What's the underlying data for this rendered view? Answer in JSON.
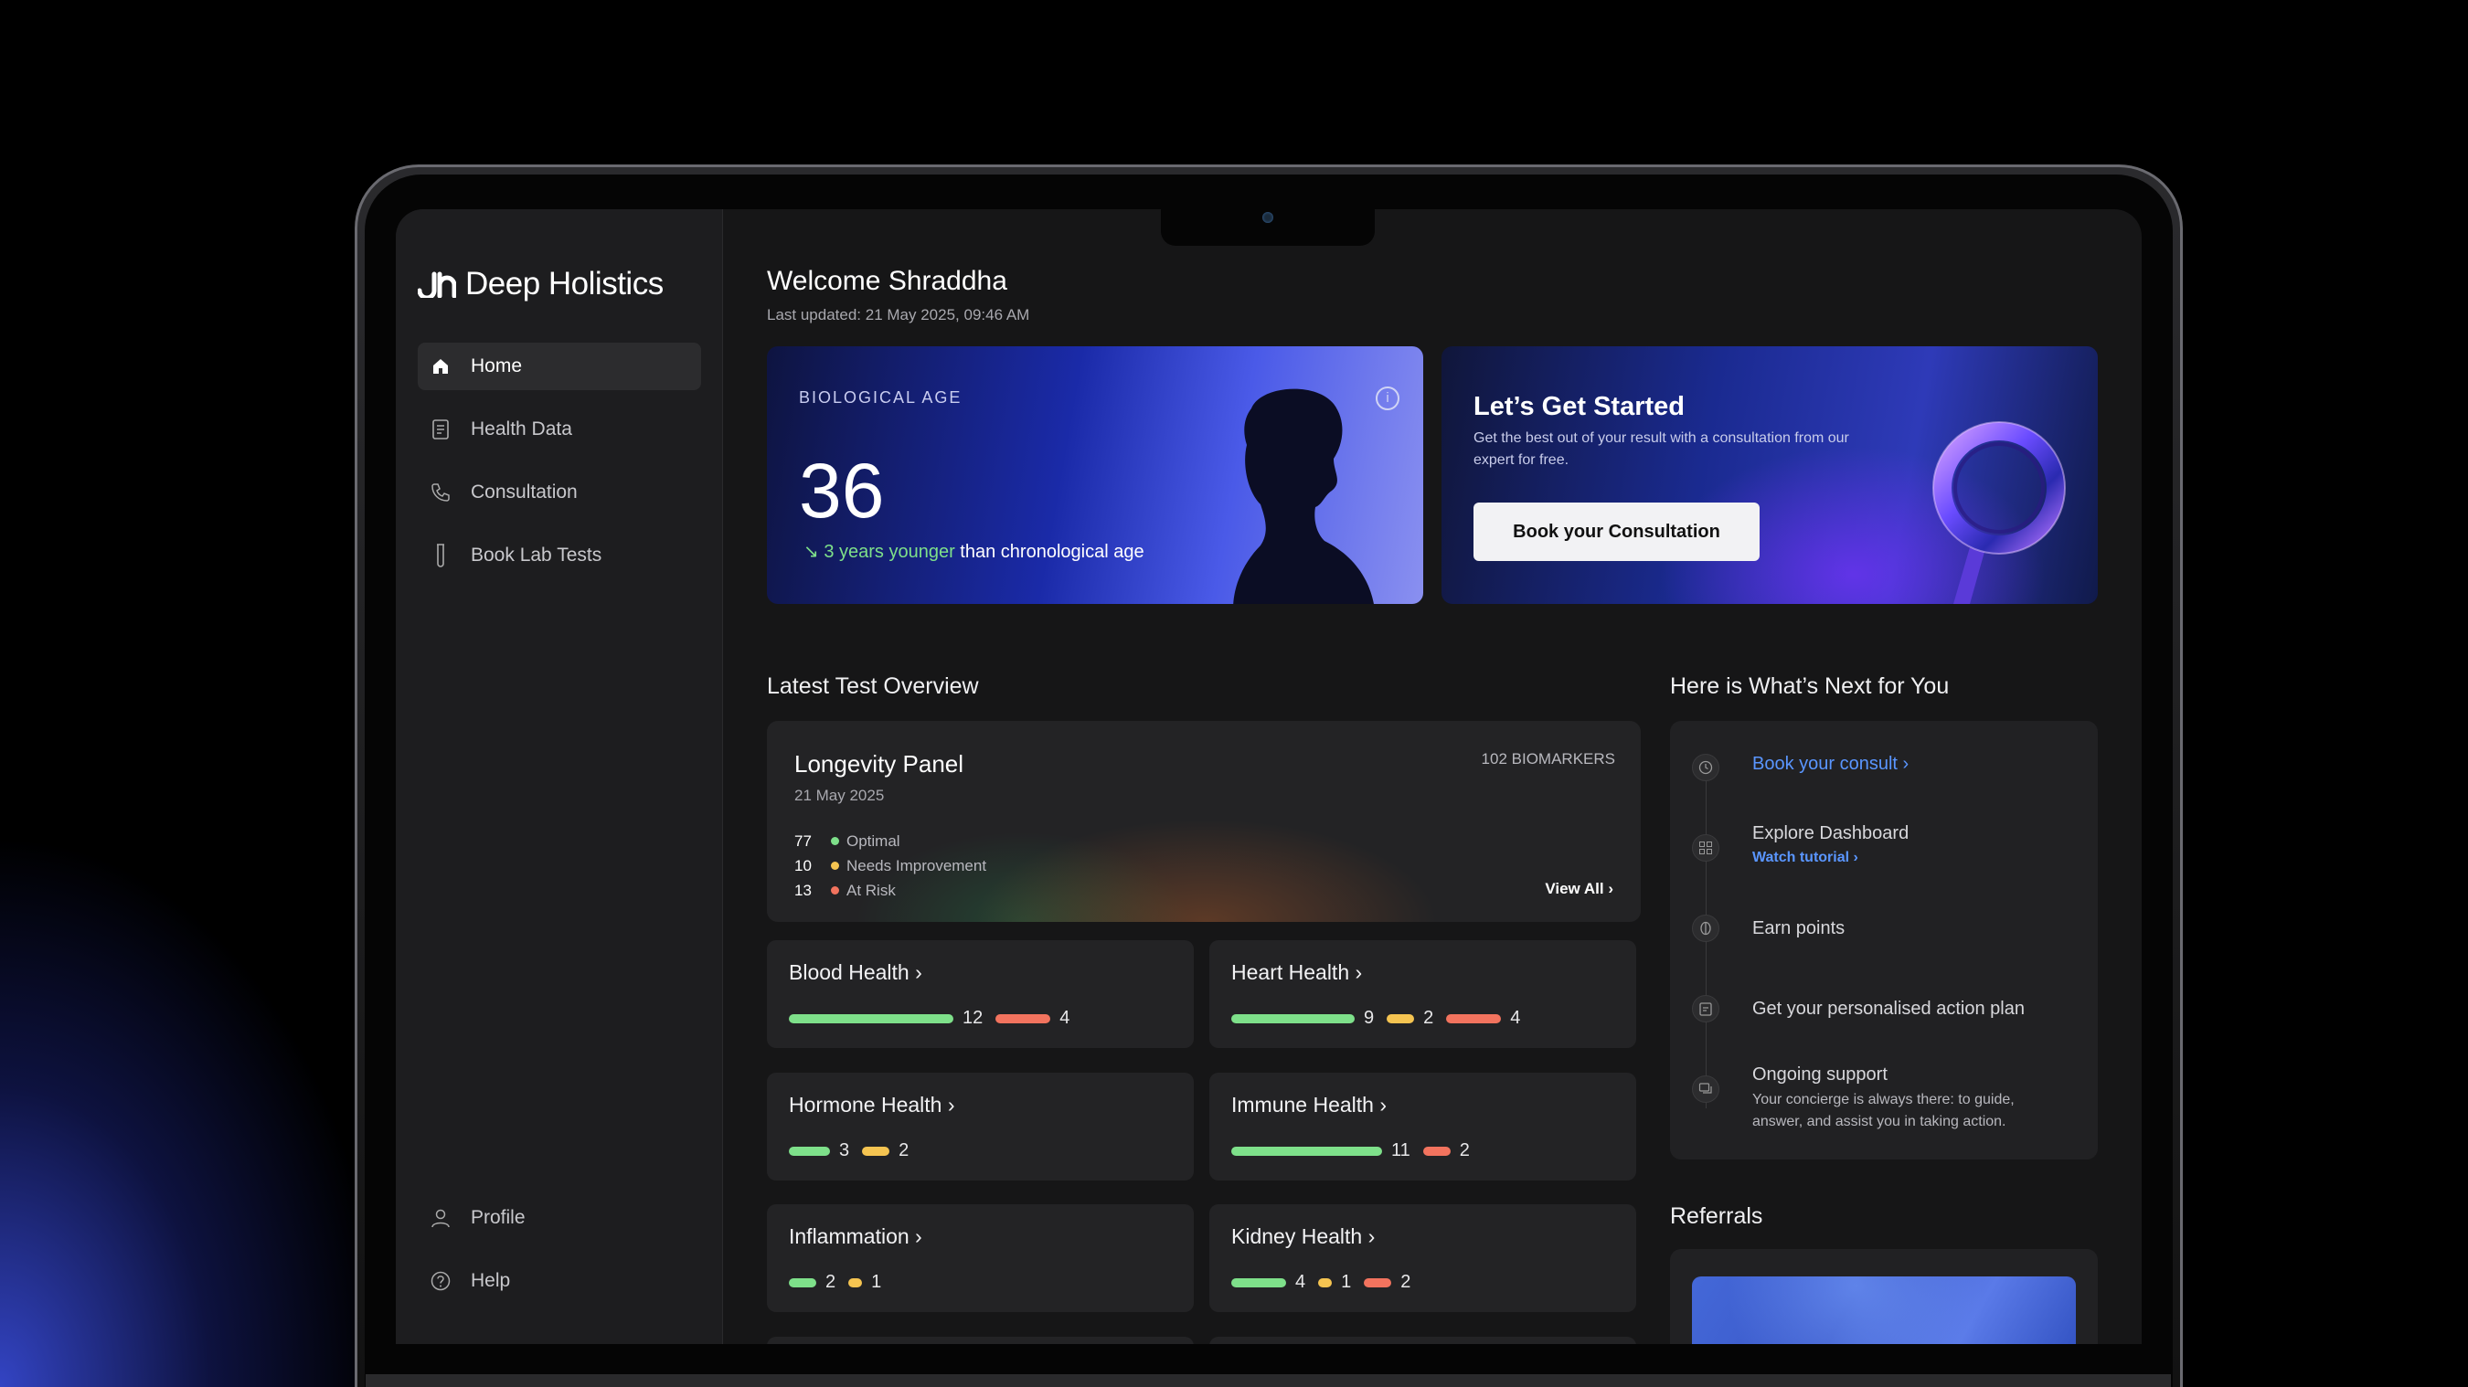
{
  "app": {
    "name": "Deep Holistics"
  },
  "sidebar": {
    "items": [
      {
        "label": "Home",
        "icon": "home-icon"
      },
      {
        "label": "Health Data",
        "icon": "document-icon"
      },
      {
        "label": "Consultation",
        "icon": "phone-icon"
      },
      {
        "label": "Book Lab Tests",
        "icon": "test-tube-icon"
      }
    ],
    "bottom": [
      {
        "label": "Profile",
        "icon": "user-icon"
      },
      {
        "label": "Help",
        "icon": "help-icon"
      }
    ]
  },
  "header": {
    "welcome": "Welcome Shraddha",
    "updated": "Last updated: 21 May 2025, 09:46 AM"
  },
  "bio_age": {
    "label": "BIOLOGICAL AGE",
    "value": "36",
    "delta": "3 years younger",
    "suffix": " than chronological age"
  },
  "get_started": {
    "title": "Let’s Get Started",
    "description": "Get the best out of your result with a consultation from our expert for free.",
    "button": "Book your Consultation"
  },
  "overview": {
    "title": "Latest Test Overview",
    "panel": {
      "name": "Longevity Panel",
      "date": "21 May 2025",
      "biomarkers": "102 BIOMARKERS",
      "legend": [
        {
          "count": "77",
          "label": "Optimal",
          "color": "#7ee08a"
        },
        {
          "count": "10",
          "label": "Needs Improvement",
          "color": "#f5c451"
        },
        {
          "count": "13",
          "label": "At Risk",
          "color": "#f2735e"
        }
      ],
      "view_all": "View All"
    },
    "categories": [
      {
        "name": "Blood Health",
        "bars": [
          {
            "value": 12,
            "label": "12",
            "color": "#7ee08a"
          },
          {
            "value": 4,
            "label": "4",
            "color": "#f2735e"
          }
        ]
      },
      {
        "name": "Heart Health",
        "bars": [
          {
            "value": 9,
            "label": "9",
            "color": "#7ee08a"
          },
          {
            "value": 2,
            "label": "2",
            "color": "#f5c451"
          },
          {
            "value": 4,
            "label": "4",
            "color": "#f2735e"
          }
        ]
      },
      {
        "name": "Hormone Health",
        "bars": [
          {
            "value": 3,
            "label": "3",
            "color": "#7ee08a"
          },
          {
            "value": 2,
            "label": "2",
            "color": "#f5c451"
          }
        ]
      },
      {
        "name": "Immune Health",
        "bars": [
          {
            "value": 11,
            "label": "11",
            "color": "#7ee08a"
          },
          {
            "value": 2,
            "label": "2",
            "color": "#f2735e"
          }
        ]
      },
      {
        "name": "Inflammation",
        "bars": [
          {
            "value": 2,
            "label": "2",
            "color": "#7ee08a"
          },
          {
            "value": 1,
            "label": "1",
            "color": "#f5c451"
          }
        ]
      },
      {
        "name": "Kidney Health",
        "bars": [
          {
            "value": 4,
            "label": "4",
            "color": "#7ee08a"
          },
          {
            "value": 1,
            "label": "1",
            "color": "#f5c451"
          },
          {
            "value": 2,
            "label": "2",
            "color": "#f2735e"
          }
        ]
      }
    ]
  },
  "next": {
    "title": "Here is What’s Next for You",
    "steps": [
      {
        "title": "Book your consult",
        "icon": "clock-icon",
        "link": true
      },
      {
        "title": "Explore Dashboard",
        "sub": "Watch tutorial",
        "icon": "grid-icon"
      },
      {
        "title": "Earn points",
        "icon": "coin-icon"
      },
      {
        "title": "Get your personalised action plan",
        "icon": "clipboard-icon"
      },
      {
        "title": "Ongoing support",
        "desc": "Your concierge is always there: to guide, answer, and assist you in taking action.",
        "icon": "chat-icon"
      }
    ]
  },
  "referrals": {
    "title": "Referrals"
  }
}
